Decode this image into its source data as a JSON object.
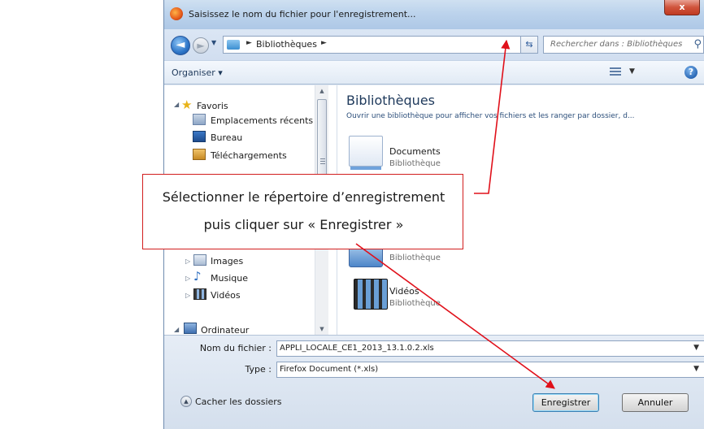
{
  "window": {
    "title": "Saisissez le nom du fichier pour l'enregistrement...",
    "close_label": "x"
  },
  "nav": {
    "address": "Bibliothèques",
    "search_placeholder": "Rechercher dans : Bibliothèques"
  },
  "toolbar": {
    "organize_label": "Organiser ▾"
  },
  "sidebar": {
    "favorites_label": "Favoris",
    "items": [
      {
        "label": "Emplacements récents",
        "icon": "recent-places-icon"
      },
      {
        "label": "Bureau",
        "icon": "desktop-icon"
      },
      {
        "label": "Téléchargements",
        "icon": "downloads-icon"
      }
    ],
    "library_items": [
      {
        "label": "Images",
        "icon": "images-icon"
      },
      {
        "label": "Musique",
        "icon": "music-icon"
      },
      {
        "label": "Vidéos",
        "icon": "videos-icon"
      }
    ],
    "computer_label": "Ordinateur"
  },
  "content": {
    "title": "Bibliothèques",
    "description": "Ouvrir une bibliothèque pour afficher vos fichiers et les ranger par dossier, d...",
    "libraries": [
      {
        "name": "Documents",
        "type": "Bibliothèque",
        "icon": "documents-library-icon"
      },
      {
        "name": "",
        "type": "Bibliothèque",
        "icon": "images-library-icon"
      },
      {
        "name": "Vidéos",
        "type": "Bibliothèque",
        "icon": "videos-library-icon"
      }
    ]
  },
  "form": {
    "filename_label": "Nom du fichier :",
    "filename_value": "APPLI_LOCALE_CE1_2013_13.1.0.2.xls",
    "type_label": "Type :",
    "type_value": "Firefox Document (*.xls)",
    "hide_folders_label": "Cacher les dossiers",
    "save_label": "Enregistrer",
    "cancel_label": "Annuler"
  },
  "callout": {
    "line1": "Sélectionner le répertoire d’enregistrement",
    "line2": "puis cliquer sur « Enregistrer »"
  },
  "colors": {
    "annotation": "#e0101a",
    "accent": "#1e395b"
  }
}
